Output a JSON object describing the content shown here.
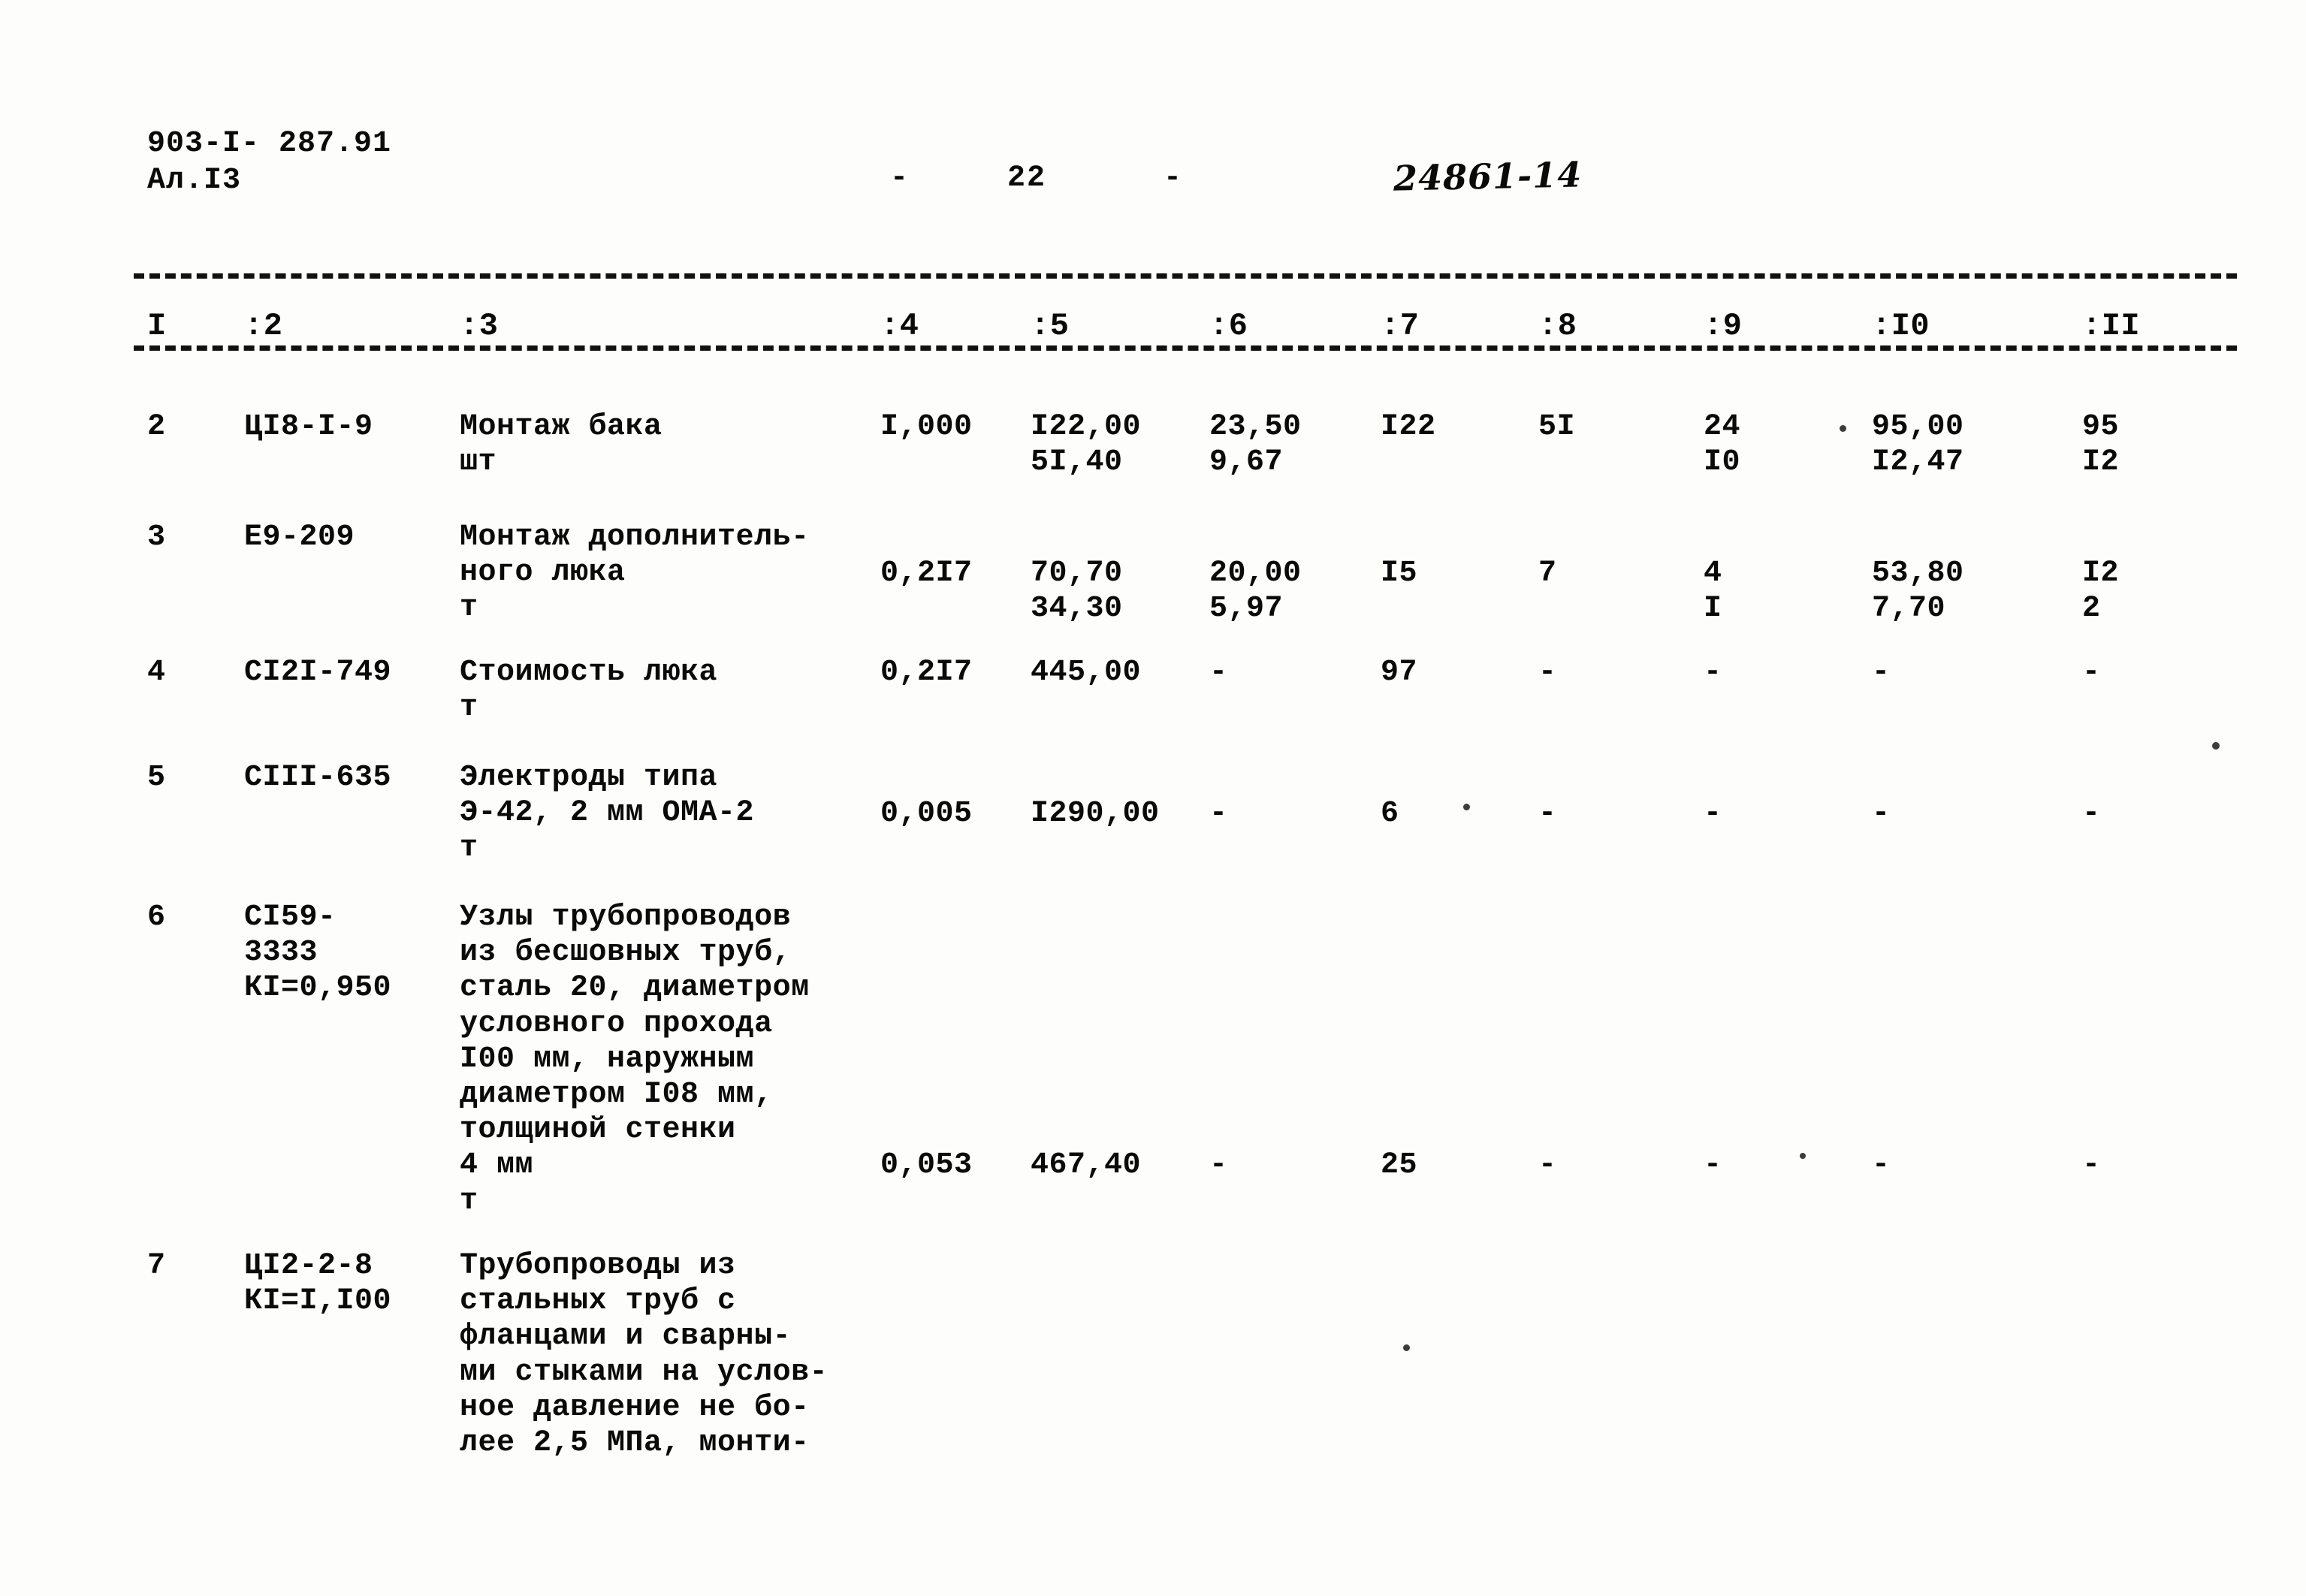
{
  "header": {
    "doc_code_line1": "903-I- 287.91",
    "doc_code_line2": "Ал.I3",
    "page_marker": "-     22      -",
    "stamp_number": "24861-14"
  },
  "table": {
    "column_headers": [
      "I",
      ":2",
      ":3",
      ":4",
      ":5",
      ":6",
      ":7",
      ":8",
      ":9",
      ":I0",
      ":II"
    ],
    "rows": [
      {
        "c1": "2",
        "c2": "ЦI8-I-9",
        "c3": "Монтаж бака\nшт",
        "c4": "I,000",
        "c5": "I22,00\n5I,40",
        "c6": "23,50\n9,67",
        "c7": "I22",
        "c8": "5I",
        "c9": "24\nI0",
        "c10": "95,00\nI2,47",
        "c11": "95\nI2"
      },
      {
        "c1": "3",
        "c2": "Е9-209",
        "c3": "Монтаж дополнитель-\nного люка\nт",
        "c4": "0,2I7",
        "c5": "70,70\n34,30",
        "c6": "20,00\n5,97",
        "c7": "I5",
        "c8": "7",
        "c9": "4\nI",
        "c10": "53,80\n7,70",
        "c11": "I2\n2"
      },
      {
        "c1": "4",
        "c2": "СI2I-749",
        "c3": "Стоимость люка\nт",
        "c4": "0,2I7",
        "c5": "445,00",
        "c6": "-",
        "c7": "97",
        "c8": "-",
        "c9": "-",
        "c10": "-",
        "c11": "-"
      },
      {
        "c1": "5",
        "c2": "СIII-635",
        "c3": "Электроды типа\nЭ-42, 2 мм ОМА-2\nт",
        "c4": "0,005",
        "c5": "I290,00",
        "c6": "-",
        "c7": "6",
        "c8": "-",
        "c9": "-",
        "c10": "-",
        "c11": "-"
      },
      {
        "c1": "6",
        "c2": "СI59-\n3333\nКI=0,950",
        "c3": "Узлы трубопроводов\nиз бесшовных труб,\nсталь 20, диаметром\nусловного прохода\nI00 мм, наружным\nдиаметром I08 мм,\nтолщиной стенки\n4 мм\nт",
        "c4": "0,053",
        "c5": "467,40",
        "c6": "-",
        "c7": "25",
        "c8": "-",
        "c9": "-",
        "c10": "-",
        "c11": "-"
      },
      {
        "c1": "7",
        "c2": "ЦI2-2-8\nКI=I,I00",
        "c3": "Трубопроводы из\nстальных труб с\nфланцами и сварны-\nми стыками на услов-\nное давление не бо-\nлее 2,5 МПа, монти-",
        "c4": "",
        "c5": "",
        "c6": "",
        "c7": "",
        "c8": "",
        "c9": "",
        "c10": "",
        "c11": ""
      }
    ]
  }
}
